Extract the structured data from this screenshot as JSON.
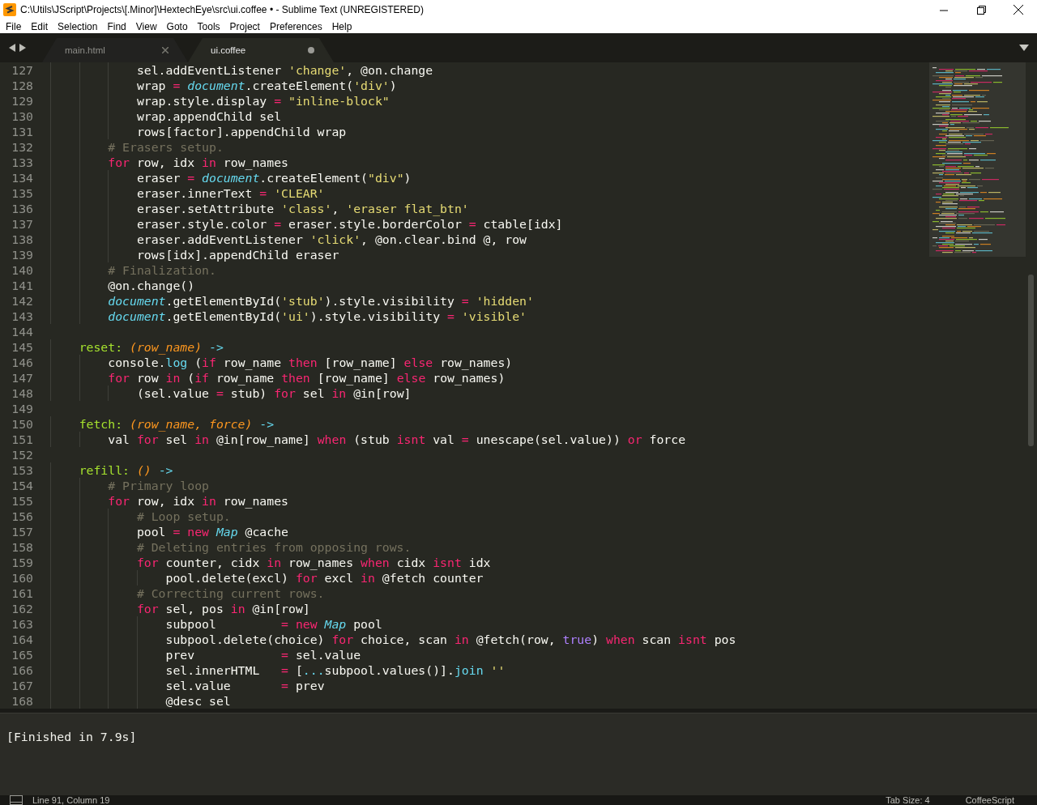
{
  "window": {
    "title": "C:\\Utils\\JScript\\Projects\\[.Minor]\\HextechEye\\src\\ui.coffee • - Sublime Text (UNREGISTERED)"
  },
  "menu": [
    "File",
    "Edit",
    "Selection",
    "Find",
    "View",
    "Goto",
    "Tools",
    "Project",
    "Preferences",
    "Help"
  ],
  "tabs": [
    {
      "label": "main.html",
      "selected": false,
      "dirty": false
    },
    {
      "label": "ui.coffee",
      "selected": true,
      "dirty": true
    }
  ],
  "editor": {
    "lines": [
      {
        "number": "127",
        "tokens": [
          {
            "kind": "plain",
            "text": "            sel.addEventListener "
          },
          {
            "kind": "string",
            "text": "'change'"
          },
          {
            "kind": "plain",
            "text": ", @on.change"
          }
        ]
      },
      {
        "number": "128",
        "tokens": [
          {
            "kind": "plain",
            "text": "            wrap "
          },
          {
            "kind": "keyword",
            "text": "= "
          },
          {
            "kind": "builtin",
            "text": "document"
          },
          {
            "kind": "plain",
            "text": ".createElement("
          },
          {
            "kind": "string",
            "text": "'div'"
          },
          {
            "kind": "plain",
            "text": ")"
          }
        ]
      },
      {
        "number": "129",
        "tokens": [
          {
            "kind": "plain",
            "text": "            wrap.style.display "
          },
          {
            "kind": "keyword",
            "text": "= "
          },
          {
            "kind": "string",
            "text": "\"inline-block\""
          }
        ]
      },
      {
        "number": "130",
        "tokens": [
          {
            "kind": "plain",
            "text": "            wrap.appendChild sel"
          }
        ]
      },
      {
        "number": "131",
        "tokens": [
          {
            "kind": "plain",
            "text": "            rows[factor].appendChild wrap"
          }
        ]
      },
      {
        "number": "132",
        "tokens": [
          {
            "kind": "comment",
            "text": "        # Erasers setup."
          }
        ]
      },
      {
        "number": "133",
        "tokens": [
          {
            "kind": "keyword",
            "text": "        for"
          },
          {
            "kind": "plain",
            "text": " row, idx "
          },
          {
            "kind": "keyword",
            "text": "in"
          },
          {
            "kind": "plain",
            "text": " row_names"
          }
        ]
      },
      {
        "number": "134",
        "tokens": [
          {
            "kind": "plain",
            "text": "            eraser "
          },
          {
            "kind": "keyword",
            "text": "= "
          },
          {
            "kind": "builtin",
            "text": "document"
          },
          {
            "kind": "plain",
            "text": ".createElement("
          },
          {
            "kind": "string",
            "text": "\"div\""
          },
          {
            "kind": "plain",
            "text": ")"
          }
        ]
      },
      {
        "number": "135",
        "tokens": [
          {
            "kind": "plain",
            "text": "            eraser.innerText "
          },
          {
            "kind": "keyword",
            "text": "= "
          },
          {
            "kind": "string",
            "text": "'CLEAR'"
          }
        ]
      },
      {
        "number": "136",
        "tokens": [
          {
            "kind": "plain",
            "text": "            eraser.setAttribute "
          },
          {
            "kind": "string",
            "text": "'class'"
          },
          {
            "kind": "plain",
            "text": ", "
          },
          {
            "kind": "string",
            "text": "'eraser flat_btn'"
          }
        ]
      },
      {
        "number": "137",
        "tokens": [
          {
            "kind": "plain",
            "text": "            eraser.style.color "
          },
          {
            "kind": "keyword",
            "text": "="
          },
          {
            "kind": "plain",
            "text": " eraser.style.borderColor "
          },
          {
            "kind": "keyword",
            "text": "="
          },
          {
            "kind": "plain",
            "text": " ctable[idx]"
          }
        ]
      },
      {
        "number": "138",
        "tokens": [
          {
            "kind": "plain",
            "text": "            eraser.addEventListener "
          },
          {
            "kind": "string",
            "text": "'click'"
          },
          {
            "kind": "plain",
            "text": ", @on.clear.bind @, row"
          }
        ]
      },
      {
        "number": "139",
        "tokens": [
          {
            "kind": "plain",
            "text": "            rows[idx].appendChild eraser"
          }
        ]
      },
      {
        "number": "140",
        "tokens": [
          {
            "kind": "comment",
            "text": "        # Finalization."
          }
        ]
      },
      {
        "number": "141",
        "tokens": [
          {
            "kind": "plain",
            "text": "        @on.change()"
          }
        ]
      },
      {
        "number": "142",
        "tokens": [
          {
            "kind": "builtin",
            "text": "        document"
          },
          {
            "kind": "plain",
            "text": ".getElementById("
          },
          {
            "kind": "string",
            "text": "'stub'"
          },
          {
            "kind": "plain",
            "text": ").style.visibility "
          },
          {
            "kind": "keyword",
            "text": "= "
          },
          {
            "kind": "string",
            "text": "'hidden'"
          }
        ]
      },
      {
        "number": "143",
        "tokens": [
          {
            "kind": "builtin",
            "text": "        document"
          },
          {
            "kind": "plain",
            "text": ".getElementById("
          },
          {
            "kind": "string",
            "text": "'ui'"
          },
          {
            "kind": "plain",
            "text": ").style.visibility "
          },
          {
            "kind": "keyword",
            "text": "= "
          },
          {
            "kind": "string",
            "text": "'visible'"
          }
        ]
      },
      {
        "number": "144"
      },
      {
        "number": "145",
        "tokens": [
          {
            "kind": "function",
            "text": "    reset: "
          },
          {
            "kind": "param",
            "text": "(row_name) "
          },
          {
            "kind": "support",
            "text": "->"
          }
        ]
      },
      {
        "number": "146",
        "tokens": [
          {
            "kind": "plain",
            "text": "        console."
          },
          {
            "kind": "support",
            "text": "log"
          },
          {
            "kind": "plain",
            "text": " ("
          },
          {
            "kind": "keyword",
            "text": "if"
          },
          {
            "kind": "plain",
            "text": " row_name "
          },
          {
            "kind": "keyword",
            "text": "then"
          },
          {
            "kind": "plain",
            "text": " [row_name] "
          },
          {
            "kind": "keyword",
            "text": "else"
          },
          {
            "kind": "plain",
            "text": " row_names)"
          }
        ]
      },
      {
        "number": "147",
        "tokens": [
          {
            "kind": "keyword",
            "text": "        for"
          },
          {
            "kind": "plain",
            "text": " row "
          },
          {
            "kind": "keyword",
            "text": "in"
          },
          {
            "kind": "plain",
            "text": " ("
          },
          {
            "kind": "keyword",
            "text": "if"
          },
          {
            "kind": "plain",
            "text": " row_name "
          },
          {
            "kind": "keyword",
            "text": "then"
          },
          {
            "kind": "plain",
            "text": " [row_name] "
          },
          {
            "kind": "keyword",
            "text": "else"
          },
          {
            "kind": "plain",
            "text": " row_names)"
          }
        ]
      },
      {
        "number": "148",
        "tokens": [
          {
            "kind": "plain",
            "text": "            (sel.value "
          },
          {
            "kind": "keyword",
            "text": "="
          },
          {
            "kind": "plain",
            "text": " stub) "
          },
          {
            "kind": "keyword",
            "text": "for"
          },
          {
            "kind": "plain",
            "text": " sel "
          },
          {
            "kind": "keyword",
            "text": "in"
          },
          {
            "kind": "plain",
            "text": " @in[row]"
          }
        ]
      },
      {
        "number": "149"
      },
      {
        "number": "150",
        "tokens": [
          {
            "kind": "function",
            "text": "    fetch: "
          },
          {
            "kind": "param",
            "text": "(row_name, force) "
          },
          {
            "kind": "support",
            "text": "->"
          }
        ]
      },
      {
        "number": "151",
        "tokens": [
          {
            "kind": "plain",
            "text": "        val "
          },
          {
            "kind": "keyword",
            "text": "for"
          },
          {
            "kind": "plain",
            "text": " sel "
          },
          {
            "kind": "keyword",
            "text": "in"
          },
          {
            "kind": "plain",
            "text": " @in[row_name] "
          },
          {
            "kind": "keyword",
            "text": "when"
          },
          {
            "kind": "plain",
            "text": " (stub "
          },
          {
            "kind": "keyword",
            "text": "isnt"
          },
          {
            "kind": "plain",
            "text": " val "
          },
          {
            "kind": "keyword",
            "text": "="
          },
          {
            "kind": "plain",
            "text": " unescape(sel.value)) "
          },
          {
            "kind": "keyword",
            "text": "or"
          },
          {
            "kind": "plain",
            "text": " force"
          }
        ]
      },
      {
        "number": "152"
      },
      {
        "number": "153",
        "tokens": [
          {
            "kind": "function",
            "text": "    refill: "
          },
          {
            "kind": "param",
            "text": "() "
          },
          {
            "kind": "support",
            "text": "->"
          }
        ]
      },
      {
        "number": "154",
        "tokens": [
          {
            "kind": "comment",
            "text": "        # Primary loop"
          }
        ]
      },
      {
        "number": "155",
        "tokens": [
          {
            "kind": "keyword",
            "text": "        for"
          },
          {
            "kind": "plain",
            "text": " row, idx "
          },
          {
            "kind": "keyword",
            "text": "in"
          },
          {
            "kind": "plain",
            "text": " row_names"
          }
        ]
      },
      {
        "number": "156",
        "tokens": [
          {
            "kind": "comment",
            "text": "            # Loop setup."
          }
        ]
      },
      {
        "number": "157",
        "tokens": [
          {
            "kind": "plain",
            "text": "            pool "
          },
          {
            "kind": "keyword",
            "text": "= new "
          },
          {
            "kind": "builtin",
            "text": "Map"
          },
          {
            "kind": "plain",
            "text": " @cache"
          }
        ]
      },
      {
        "number": "158",
        "tokens": [
          {
            "kind": "comment",
            "text": "            # Deleting entries from opposing rows."
          }
        ]
      },
      {
        "number": "159",
        "tokens": [
          {
            "kind": "keyword",
            "text": "            for"
          },
          {
            "kind": "plain",
            "text": " counter, cidx "
          },
          {
            "kind": "keyword",
            "text": "in"
          },
          {
            "kind": "plain",
            "text": " row_names "
          },
          {
            "kind": "keyword",
            "text": "when"
          },
          {
            "kind": "plain",
            "text": " cidx "
          },
          {
            "kind": "keyword",
            "text": "isnt"
          },
          {
            "kind": "plain",
            "text": " idx"
          }
        ]
      },
      {
        "number": "160",
        "tokens": [
          {
            "kind": "plain",
            "text": "                pool.delete(excl) "
          },
          {
            "kind": "keyword",
            "text": "for"
          },
          {
            "kind": "plain",
            "text": " excl "
          },
          {
            "kind": "keyword",
            "text": "in"
          },
          {
            "kind": "plain",
            "text": " @fetch counter"
          }
        ]
      },
      {
        "number": "161",
        "tokens": [
          {
            "kind": "comment",
            "text": "            # Correcting current rows."
          }
        ]
      },
      {
        "number": "162",
        "tokens": [
          {
            "kind": "keyword",
            "text": "            for"
          },
          {
            "kind": "plain",
            "text": " sel, pos "
          },
          {
            "kind": "keyword",
            "text": "in"
          },
          {
            "kind": "plain",
            "text": " @in[row]"
          }
        ]
      },
      {
        "number": "163",
        "tokens": [
          {
            "kind": "plain",
            "text": "                subpool         "
          },
          {
            "kind": "keyword",
            "text": "= new "
          },
          {
            "kind": "builtin",
            "text": "Map"
          },
          {
            "kind": "plain",
            "text": " pool"
          }
        ]
      },
      {
        "number": "164",
        "tokens": [
          {
            "kind": "plain",
            "text": "                subpool.delete(choice) "
          },
          {
            "kind": "keyword",
            "text": "for"
          },
          {
            "kind": "plain",
            "text": " choice, scan "
          },
          {
            "kind": "keyword",
            "text": "in"
          },
          {
            "kind": "plain",
            "text": " @fetch(row, "
          },
          {
            "kind": "constant",
            "text": "true"
          },
          {
            "kind": "plain",
            "text": ") "
          },
          {
            "kind": "keyword",
            "text": "when"
          },
          {
            "kind": "plain",
            "text": " scan "
          },
          {
            "kind": "keyword",
            "text": "isnt"
          },
          {
            "kind": "plain",
            "text": " pos"
          }
        ]
      },
      {
        "number": "165",
        "tokens": [
          {
            "kind": "plain",
            "text": "                prev            "
          },
          {
            "kind": "keyword",
            "text": "="
          },
          {
            "kind": "plain",
            "text": " sel.value"
          }
        ]
      },
      {
        "number": "166",
        "tokens": [
          {
            "kind": "plain",
            "text": "                sel.innerHTML   "
          },
          {
            "kind": "keyword",
            "text": "="
          },
          {
            "kind": "plain",
            "text": " ["
          },
          {
            "kind": "support",
            "text": "..."
          },
          {
            "kind": "plain",
            "text": "subpool.values()]."
          },
          {
            "kind": "support",
            "text": "join "
          },
          {
            "kind": "string",
            "text": "''"
          }
        ]
      },
      {
        "number": "167",
        "tokens": [
          {
            "kind": "plain",
            "text": "                sel.value       "
          },
          {
            "kind": "keyword",
            "text": "="
          },
          {
            "kind": "plain",
            "text": " prev"
          }
        ]
      },
      {
        "number": "168",
        "tokens": [
          {
            "kind": "plain",
            "text": "                @desc sel"
          }
        ]
      }
    ]
  },
  "output": {
    "text": "[Finished in 7.9s]"
  },
  "status_bar": {
    "position": "Line 91, Column 19",
    "tab_size": "Tab Size: 4",
    "syntax": "CoffeeScript"
  }
}
